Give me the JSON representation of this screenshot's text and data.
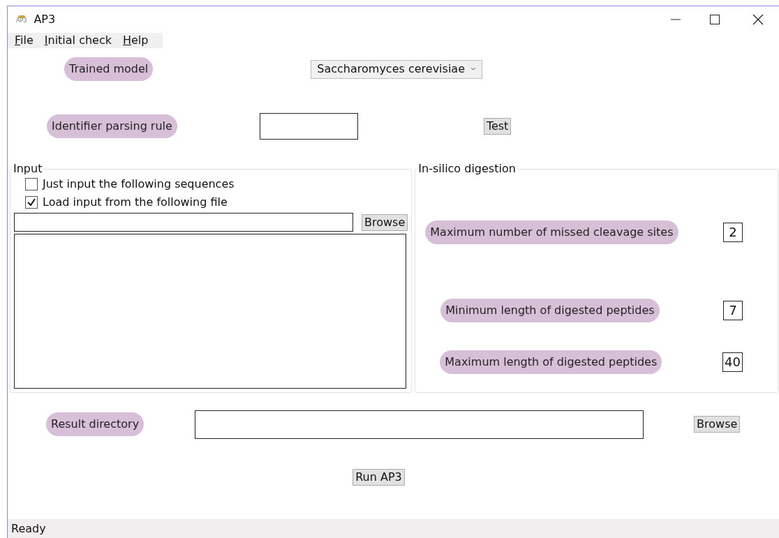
{
  "window": {
    "title": "AP3",
    "icon_text": "AP3"
  },
  "menu": [
    "File",
    "Initial check",
    "Help"
  ],
  "trained_model": {
    "label": "Trained model",
    "value": "Saccharomyces cerevisiae"
  },
  "identifier_parsing_rule": {
    "label": "Identifier parsing rule",
    "button": "Test"
  },
  "input_group": {
    "title": "Input",
    "options": [
      {
        "label": "Just input the following sequences",
        "checked": false
      },
      {
        "label": "Load input from the following file",
        "checked": true
      }
    ],
    "browse": "Browse"
  },
  "digestion_group": {
    "title": "In-silico digestion",
    "params": [
      {
        "label": "Maximum number of missed cleavage sites",
        "value": "2"
      },
      {
        "label": "Minimum length of digested peptides",
        "value": "7"
      },
      {
        "label": "Maximum length of digested peptides",
        "value": "40"
      }
    ]
  },
  "result_directory": {
    "label": "Result directory",
    "browse": "Browse"
  },
  "run_button": "Run AP3",
  "status_bar": "Ready"
}
